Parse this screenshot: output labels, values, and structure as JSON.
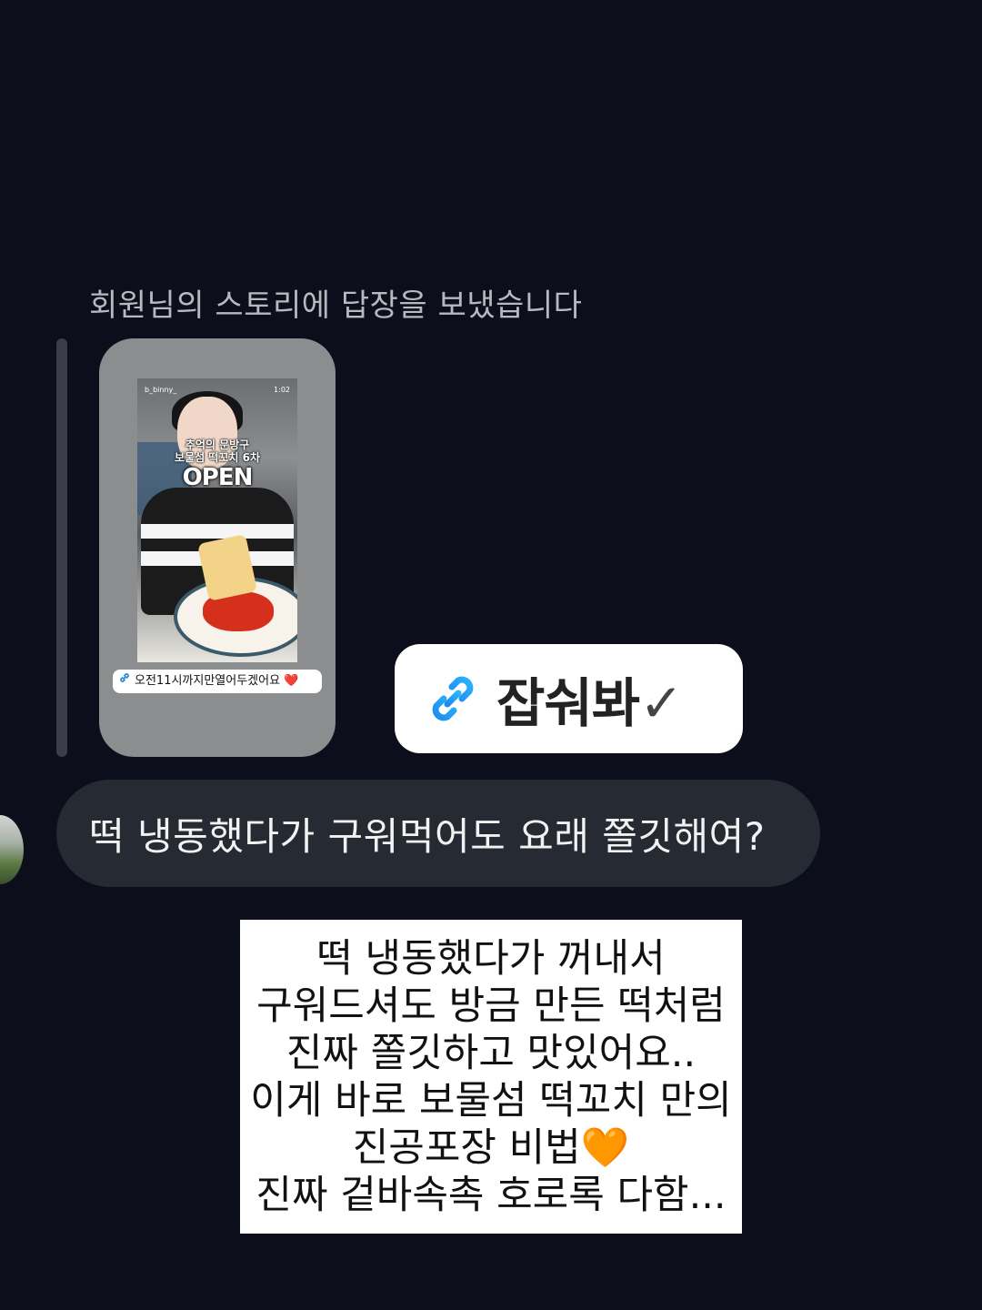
{
  "reply_note": "회원님의 스토리에 답장을 보냈습니다",
  "story": {
    "username": "b_binny_",
    "time": "1:02",
    "title_line1": "추억의 문방구",
    "title_line2": "보물섬 떡꼬치 6차",
    "open_text": "OPEN",
    "link_text": "오전11시까지만열어두겠어요",
    "link_emoji": "❤️"
  },
  "sticker": {
    "text": "잡숴봐",
    "check": "✓"
  },
  "message": {
    "text": "떡 냉동했다가 구워먹어도 요래 쫄깃해여?"
  },
  "caption": {
    "lines": [
      "떡 냉동했다가 꺼내서",
      "구워드셔도 방금 만든 떡처럼",
      "진짜 쫄깃하고 맛있어요..",
      "이게 바로 보물섬 떡꼬치 만의",
      "진공포장 비법",
      "진짜 겉바속촉 호로록 다함..."
    ],
    "heart_emoji": "🧡"
  },
  "colors": {
    "background": "#0c0f1b",
    "bubble": "#262a33",
    "link_blue": "#1e88e5"
  },
  "icons": {
    "link": "link-icon",
    "heart": "heart-icon"
  }
}
